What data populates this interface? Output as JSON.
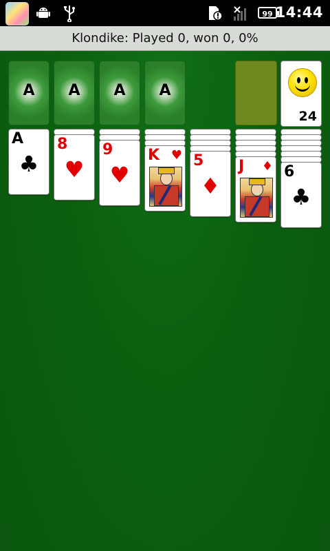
{
  "status_bar": {
    "time": "14:44",
    "battery": "99",
    "icons": [
      "app-store-icon",
      "android-icon",
      "usb-icon",
      "sd-card-alert-icon",
      "no-signal-icon",
      "battery-icon"
    ]
  },
  "header": {
    "text": "Klondike:  Played 0, won 0, 0%"
  },
  "foundations": [
    {
      "label": "A"
    },
    {
      "label": "A"
    },
    {
      "label": "A"
    },
    {
      "label": "A"
    }
  ],
  "stock": {
    "count": "24",
    "icon": "smiley-icon"
  },
  "tableau": [
    {
      "hidden": 0,
      "rank": "A",
      "suit": "♣",
      "color": "black"
    },
    {
      "hidden": 1,
      "rank": "8",
      "suit": "♥",
      "color": "red"
    },
    {
      "hidden": 2,
      "rank": "9",
      "suit": "♥",
      "color": "red"
    },
    {
      "hidden": 3,
      "rank": "K",
      "suit": "♥",
      "color": "red",
      "court": true
    },
    {
      "hidden": 4,
      "rank": "5",
      "suit": "♦",
      "color": "red"
    },
    {
      "hidden": 5,
      "rank": "J",
      "suit": "♦",
      "color": "red",
      "court": true
    },
    {
      "hidden": 6,
      "rank": "6",
      "suit": "♣",
      "color": "black"
    }
  ],
  "colors": {
    "felt": "#0b5c10",
    "header_bg": "#d7dcd7",
    "waste": "#6e8a1e",
    "red_suit": "#e00000"
  }
}
